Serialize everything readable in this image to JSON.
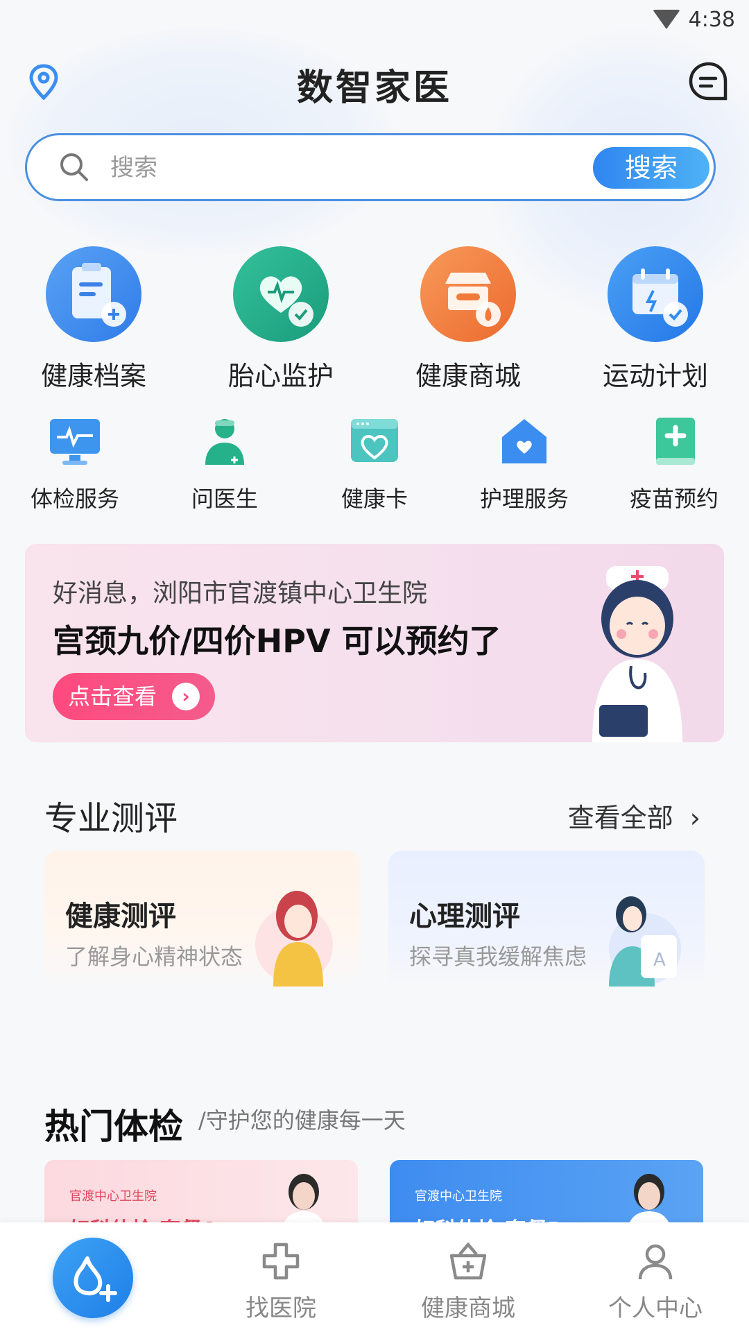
{
  "status_bar": {
    "time": "4:38"
  },
  "header": {
    "title": "数智家医"
  },
  "search": {
    "placeholder": "搜索",
    "button_label": "搜索"
  },
  "main_services": [
    {
      "label": "健康档案",
      "icon": "health-record-icon",
      "color": "#3b82e6"
    },
    {
      "label": "胎心监护",
      "icon": "fetal-heart-icon",
      "color": "#23b08e"
    },
    {
      "label": "健康商城",
      "icon": "health-mall-icon",
      "color": "#f07a3a"
    },
    {
      "label": "运动计划",
      "icon": "exercise-plan-icon",
      "color": "#2f8cf0"
    }
  ],
  "sub_services": [
    {
      "label": "体检服务",
      "icon": "checkup-monitor-icon"
    },
    {
      "label": "问医生",
      "icon": "doctor-icon"
    },
    {
      "label": "健康卡",
      "icon": "health-card-icon"
    },
    {
      "label": "护理服务",
      "icon": "nursing-home-icon"
    },
    {
      "label": "疫苗预约",
      "icon": "vaccine-book-icon"
    }
  ],
  "banner": {
    "subtitle": "好消息，浏阳市官渡镇中心卫生院",
    "title": "宫颈九价/四价HPV 可以预约了",
    "button_label": "点击查看"
  },
  "evaluation": {
    "section_title": "专业测评",
    "see_all_label": "查看全部",
    "cards": [
      {
        "title": "健康测评",
        "subtitle": "了解身心精神状态"
      },
      {
        "title": "心理测评",
        "subtitle": "探寻真我缓解焦虑"
      }
    ]
  },
  "hot_checkup": {
    "title": "热门体检",
    "subtitle": "/守护您的健康每一天",
    "packages": [
      {
        "hospital": "官渡中心卫生院",
        "name": "妇科体检 套餐A"
      },
      {
        "hospital": "官渡中心卫生院",
        "name": "妇科体检 套餐B"
      }
    ]
  },
  "bottom_nav": {
    "items": [
      {
        "label": "",
        "icon": "home-fab-icon"
      },
      {
        "label": "找医院",
        "icon": "hospital-cross-icon"
      },
      {
        "label": "健康商城",
        "icon": "shopping-basket-icon"
      },
      {
        "label": "个人中心",
        "icon": "user-icon"
      }
    ]
  }
}
